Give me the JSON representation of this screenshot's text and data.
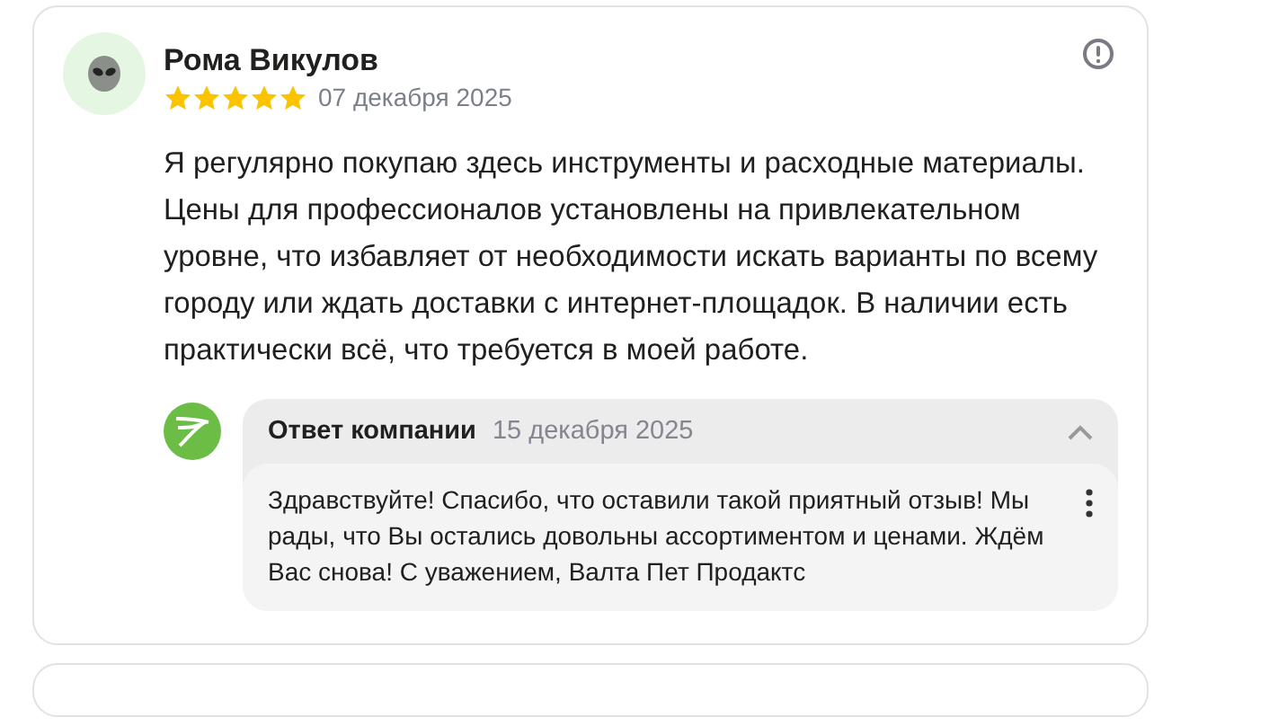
{
  "review": {
    "author": "Рома Викулов",
    "stars": 5,
    "date": "07 декабря 2025",
    "text": "Я регулярно покупаю здесь инструменты и расходные материалы. Цены для профессионалов установлены на привлекательном уровне, что избавляет от необходимости искать варианты по всему городу или ждать доставки с интернет-площадок. В наличии есть практически всё, что требуется в моей работе.",
    "reply": {
      "title": "Ответ компании",
      "date": "15 декабря 2025",
      "expanded": true,
      "text": "Здравствуйте! Спасибо, что оставили такой приятный отзыв! Мы рады, что Вы остались довольны ассортиментом и ценами. Ждём Вас снова! С уважением, Валта Пет Продактс"
    }
  }
}
